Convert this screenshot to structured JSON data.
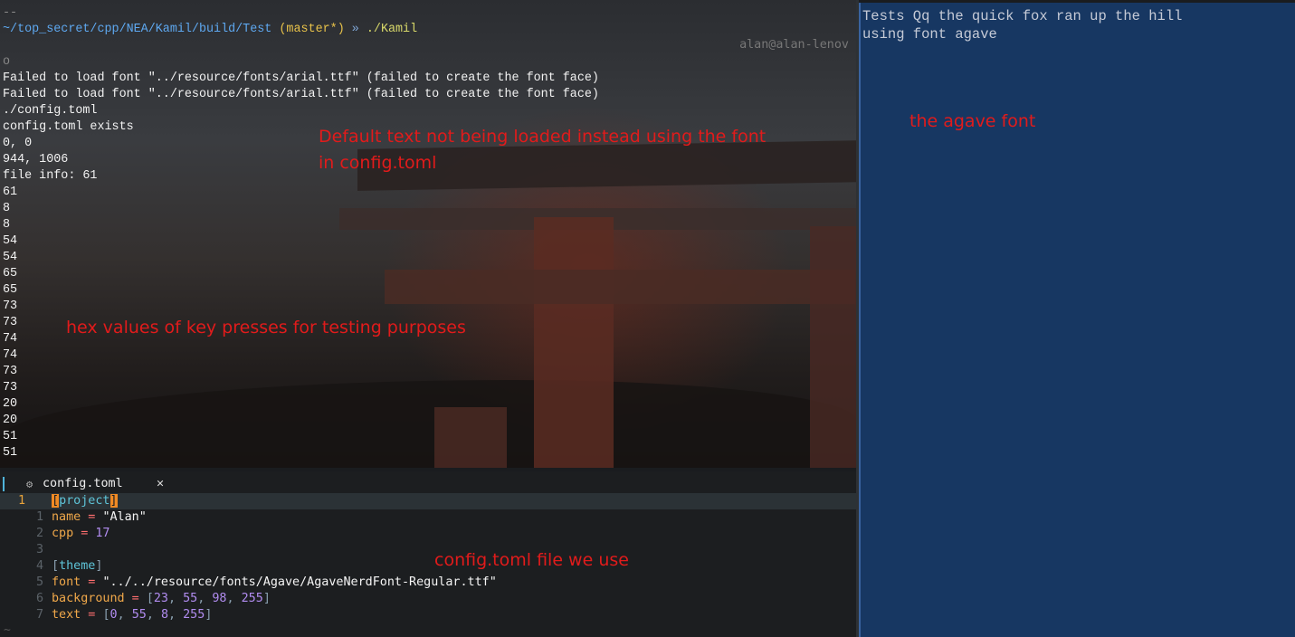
{
  "terminal": {
    "top_dashes": "--",
    "prompt": {
      "path": "~/top_secret/cpp/NEA/Kamil/build/Test",
      "branch": "master",
      "dirty": "*",
      "arrow": "»",
      "command": "./Kamil"
    },
    "right_prompt": "alan@alan-lenov",
    "output_lines": [
      "o",
      "Failed to load font \"../resource/fonts/arial.ttf\" (failed to create the font face)",
      "Failed to load font \"../resource/fonts/arial.ttf\" (failed to create the font face)",
      "./config.toml",
      "config.toml exists",
      "0, 0",
      "944, 1006",
      "file info: 61",
      "61",
      "8",
      "8",
      "54",
      "54",
      "65",
      "65",
      "73",
      "73",
      "74",
      "74",
      "73",
      "73",
      "20",
      "20",
      "51",
      "51"
    ]
  },
  "annotations": {
    "default_text_line1": "Default text not being loaded instead using the font",
    "default_text_line2": "in config.toml",
    "hex_values": "hex values of key presses for testing purposes",
    "config_file": "config.toml file we use",
    "agave_font": "the agave font"
  },
  "editor": {
    "tab_icon": "gear-icon",
    "tab_label": "config.toml",
    "tab_close": "✕",
    "current_line_number": "1",
    "lines": [
      {
        "n": "1",
        "tokens": [
          [
            "cursor",
            "["
          ],
          [
            "k-table",
            "project"
          ],
          [
            "cursor",
            "]"
          ]
        ]
      },
      {
        "n": "1",
        "tokens": [
          [
            "k-key",
            "name"
          ],
          [
            "k-eq",
            " = "
          ],
          [
            "k-str",
            "\"Alan\""
          ]
        ]
      },
      {
        "n": "2",
        "tokens": [
          [
            "k-key",
            "cpp"
          ],
          [
            "k-eq",
            " = "
          ],
          [
            "k-num",
            "17"
          ]
        ]
      },
      {
        "n": "3",
        "tokens": []
      },
      {
        "n": "4",
        "tokens": [
          [
            "k-bracket",
            "["
          ],
          [
            "k-table",
            "theme"
          ],
          [
            "k-bracket",
            "]"
          ]
        ]
      },
      {
        "n": "5",
        "tokens": [
          [
            "k-key",
            "font"
          ],
          [
            "k-eq",
            " = "
          ],
          [
            "k-str",
            "\"../../resource/fonts/Agave/AgaveNerdFont-Regular.ttf\""
          ]
        ]
      },
      {
        "n": "6",
        "tokens": [
          [
            "k-key",
            "background"
          ],
          [
            "k-eq",
            " = "
          ],
          [
            "k-bracket",
            "["
          ],
          [
            "k-num",
            "23"
          ],
          [
            "k-bracket",
            ", "
          ],
          [
            "k-num",
            "55"
          ],
          [
            "k-bracket",
            ", "
          ],
          [
            "k-num",
            "98"
          ],
          [
            "k-bracket",
            ", "
          ],
          [
            "k-num",
            "255"
          ],
          [
            "k-bracket",
            "]"
          ]
        ]
      },
      {
        "n": "7",
        "tokens": [
          [
            "k-key",
            "text"
          ],
          [
            "k-eq",
            " = "
          ],
          [
            "k-bracket",
            "["
          ],
          [
            "k-num",
            "0"
          ],
          [
            "k-bracket",
            ", "
          ],
          [
            "k-num",
            "55"
          ],
          [
            "k-bracket",
            ", "
          ],
          [
            "k-num",
            "8"
          ],
          [
            "k-bracket",
            ", "
          ],
          [
            "k-num",
            "255"
          ],
          [
            "k-bracket",
            "]"
          ]
        ]
      }
    ],
    "tilde": "~"
  },
  "agave_window": {
    "line1": "Tests Qq the quick fox ran up the hill",
    "line2": "using font agave",
    "background": "#173762"
  }
}
